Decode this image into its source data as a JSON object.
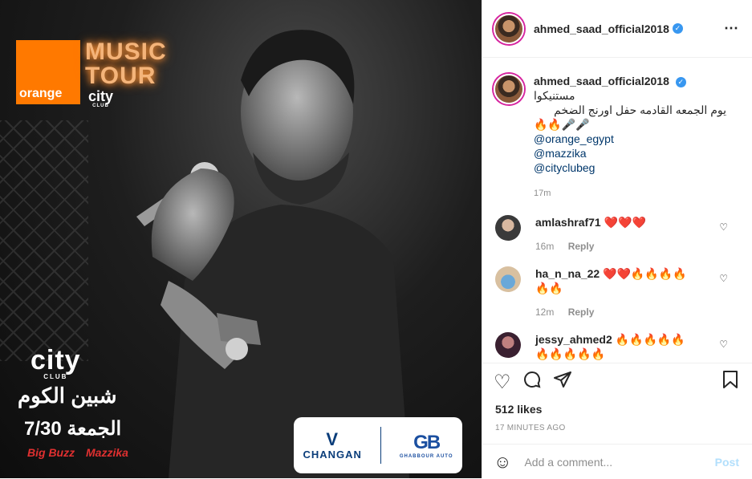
{
  "poster": {
    "brand": "orange",
    "music_line1": "MUSIC",
    "music_line2": "TOUR",
    "city_small": "city",
    "club_small": "CLUB",
    "city_big": "city",
    "club_big": "CLUB",
    "venue": "شبين الكوم",
    "date": "الجمعة 7/30",
    "sponsor1": "Big Buzz",
    "sponsor2": "Mazzika",
    "changan": "CHANGAN",
    "ghabbour_mark": "GB",
    "ghabbour": "GHABBOUR AUTO"
  },
  "post": {
    "username": "ahmed_saad_official2018",
    "more_icon": "⋯",
    "caption": {
      "username": "ahmed_saad_official2018",
      "text_line1": "مستنيكوا",
      "text_line2": "يوم الجمعه القادمه حفل اورنج الضخم",
      "emojis": "🔥🔥🎤🎤",
      "mentions": [
        "@orange_egypt",
        "@mazzika",
        "@cityclubeg"
      ],
      "time": "17m"
    },
    "comments": [
      {
        "user": "amlashraf71",
        "text": "❤️❤️❤️",
        "time": "16m",
        "reply": "Reply"
      },
      {
        "user": "ha_n_na_22",
        "text": "❤️❤️🔥🔥🔥🔥🔥🔥",
        "time": "12m",
        "reply": "Reply"
      },
      {
        "user": "jessy_ahmed2",
        "text": "🔥🔥🔥🔥🔥🔥🔥🔥🔥🔥",
        "time": "",
        "reply": ""
      }
    ],
    "likes": "512 likes",
    "time_ago": "17 MINUTES AGO",
    "add_comment_placeholder": "Add a comment...",
    "post_label": "Post"
  },
  "colors": {
    "link": "#00376b",
    "verified": "#3897f0",
    "orange": "#ff7900",
    "post_disabled": "#b2dffc"
  }
}
